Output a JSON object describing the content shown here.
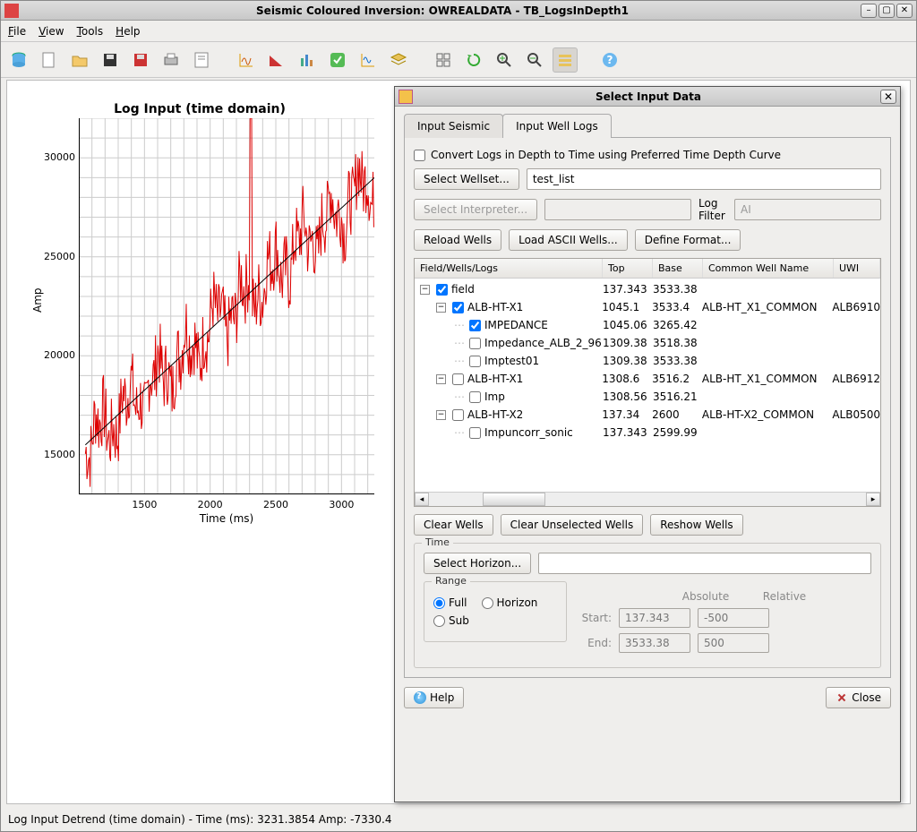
{
  "window": {
    "title": "Seismic Coloured Inversion: OWREALDATA - TB_LogsInDepth1"
  },
  "menu": {
    "file": "File",
    "view": "View",
    "tools": "Tools",
    "help": "Help"
  },
  "chart_data": {
    "type": "line",
    "title": "Log Input (time domain)",
    "xlabel": "Time (ms)",
    "ylabel": "Amp",
    "xlim": [
      1000,
      3250
    ],
    "ylim": [
      13000,
      32000
    ],
    "xticks": [
      1500,
      2000,
      2500,
      3000
    ],
    "yticks": [
      15000,
      20000,
      25000,
      30000
    ],
    "trend": {
      "x": [
        1050,
        3250
      ],
      "y": [
        15500,
        29000
      ]
    },
    "note": "single noisy red series roughly linearly increasing from ~15000 at t=1050 to ~30000 at t=3200"
  },
  "status": "Log Input Detrend (time domain)  -  Time (ms): 3231.3854  Amp: -7330.4",
  "dialog": {
    "title": "Select Input Data",
    "tabs": {
      "seismic": "Input Seismic",
      "logs": "Input Well Logs"
    },
    "convert_label": "Convert Logs in Depth to Time using Preferred Time Depth Curve",
    "select_wellset": "Select Wellset...",
    "wellset_value": "test_list",
    "select_interpreter": "Select Interpreter...",
    "log_filter_label": "Log Filter",
    "log_filter_value": "AI",
    "reload": "Reload Wells",
    "load_ascii": "Load ASCII Wells...",
    "define_format": "Define Format...",
    "cols": {
      "c1": "Field/Wells/Logs",
      "c2": "Top",
      "c3": "Base",
      "c4": "Common Well Name",
      "c5": "UWI"
    },
    "tree": [
      {
        "indent": 0,
        "exp": "-",
        "chk": true,
        "name": "field",
        "top": "137.343",
        "base": "3533.38",
        "cwn": "",
        "uwi": ""
      },
      {
        "indent": 1,
        "exp": "-",
        "chk": true,
        "name": "ALB-HT-X1",
        "top": "1045.1",
        "base": "3533.4",
        "cwn": "ALB-HT_X1_COMMON",
        "uwi": "ALB6910"
      },
      {
        "indent": 2,
        "exp": "",
        "chk": true,
        "name": "IMPEDANCE",
        "top": "1045.06",
        "base": "3265.42",
        "cwn": "",
        "uwi": ""
      },
      {
        "indent": 2,
        "exp": "",
        "chk": false,
        "name": "Impedance_ALB_2_96",
        "top": "1309.38",
        "base": "3518.38",
        "cwn": "",
        "uwi": ""
      },
      {
        "indent": 2,
        "exp": "",
        "chk": false,
        "name": "Imptest01",
        "top": "1309.38",
        "base": "3533.38",
        "cwn": "",
        "uwi": ""
      },
      {
        "indent": 1,
        "exp": "-",
        "chk": false,
        "name": "ALB-HT-X1",
        "top": "1308.6",
        "base": "3516.2",
        "cwn": "ALB-HT_X1_COMMON",
        "uwi": "ALB6912"
      },
      {
        "indent": 2,
        "exp": "",
        "chk": false,
        "name": "Imp",
        "top": "1308.56",
        "base": "3516.21",
        "cwn": "",
        "uwi": ""
      },
      {
        "indent": 1,
        "exp": "-",
        "chk": false,
        "name": "ALB-HT-X2",
        "top": "137.34",
        "base": "2600",
        "cwn": "ALB-HT-X2_COMMON",
        "uwi": "ALB0500"
      },
      {
        "indent": 2,
        "exp": "",
        "chk": false,
        "name": "Impuncorr_sonic",
        "top": "137.343",
        "base": "2599.99",
        "cwn": "",
        "uwi": ""
      }
    ],
    "clear_wells": "Clear Wells",
    "clear_unselected": "Clear Unselected Wells",
    "reshow": "Reshow Wells",
    "time_legend": "Time",
    "select_horizon": "Select Horizon...",
    "range_legend": "Range",
    "radio_full": "Full",
    "radio_horizon": "Horizon",
    "radio_sub": "Sub",
    "absolute": "Absolute",
    "relative": "Relative",
    "start_label": "Start:",
    "end_label": "End:",
    "start_abs": "137.343",
    "end_abs": "3533.38",
    "start_rel": "-500",
    "end_rel": "500",
    "help": "Help",
    "close": "Close"
  }
}
